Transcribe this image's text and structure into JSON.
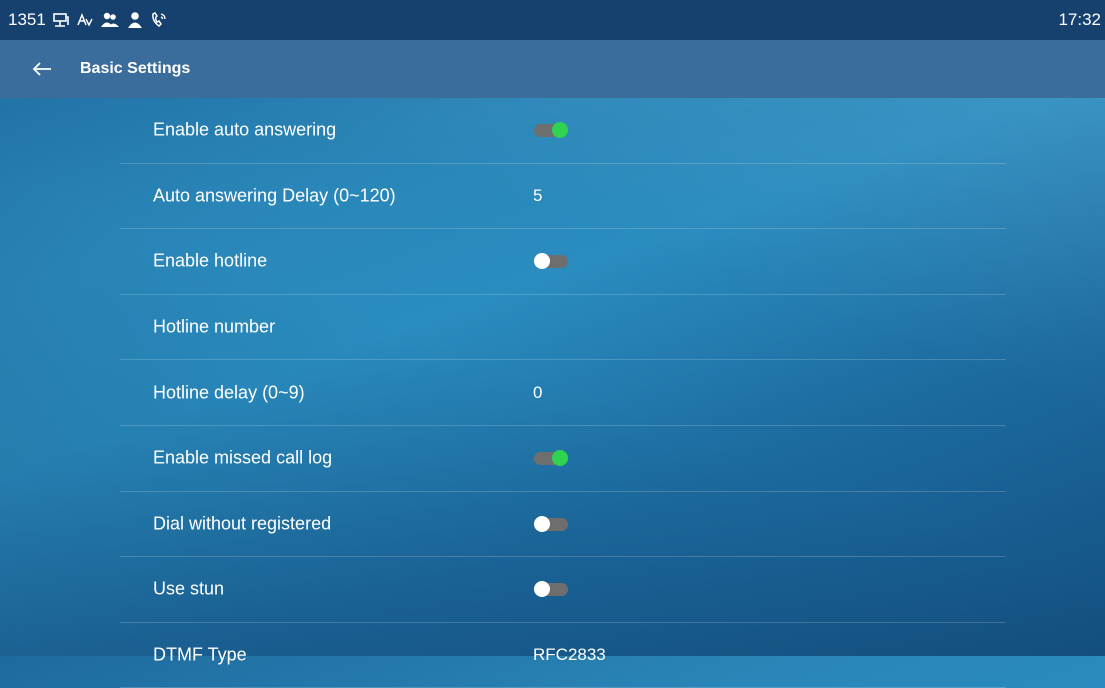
{
  "status_bar": {
    "line_number": "1351",
    "time": "17:32",
    "icons": [
      "network-icon",
      "ime-icon",
      "contacts-icon",
      "user-icon",
      "auto-answer-icon"
    ]
  },
  "header": {
    "back_icon": "arrow-left-icon",
    "title": "Basic Settings"
  },
  "settings": [
    {
      "label": "Enable auto answering",
      "type": "toggle",
      "state": "on"
    },
    {
      "label": "Auto answering Delay (0~120)",
      "type": "value",
      "value": "5"
    },
    {
      "label": "Enable hotline",
      "type": "toggle",
      "state": "off"
    },
    {
      "label": "Hotline number",
      "type": "value",
      "value": ""
    },
    {
      "label": "Hotline delay (0~9)",
      "type": "value",
      "value": "0"
    },
    {
      "label": "Enable missed call log",
      "type": "toggle",
      "state": "on"
    },
    {
      "label": "Dial without registered",
      "type": "toggle",
      "state": "off"
    },
    {
      "label": "Use stun",
      "type": "toggle",
      "state": "off"
    },
    {
      "label": "DTMF Type",
      "type": "value",
      "value": "RFC2833"
    }
  ],
  "colors": {
    "status_bar": "#16406e",
    "title_bar": "#3a6d9b",
    "toggle_on": "#2fd34f",
    "toggle_track": "#6e6e6e"
  }
}
